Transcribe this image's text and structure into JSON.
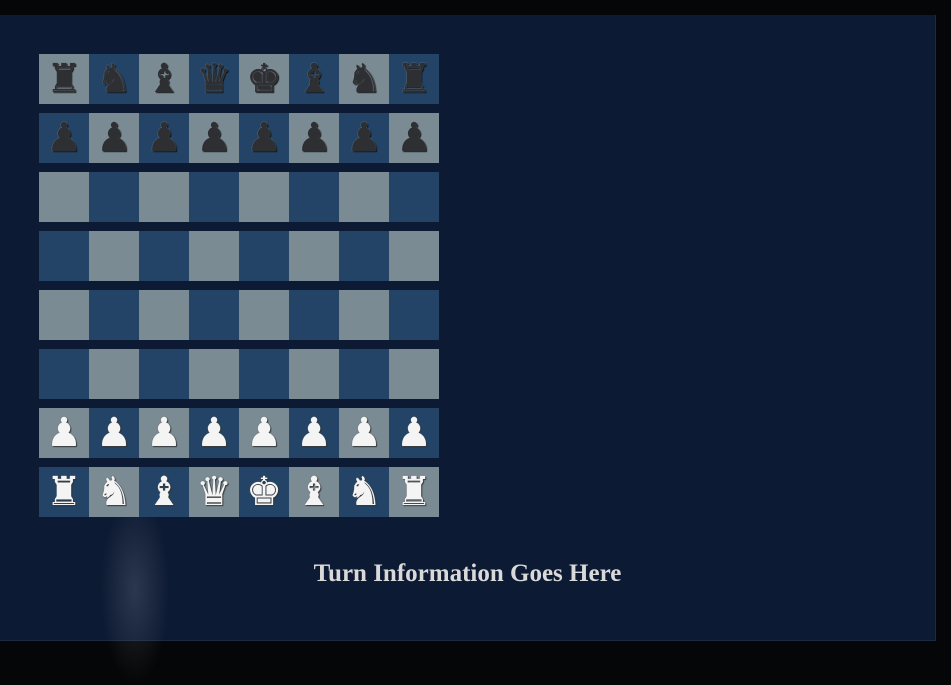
{
  "theme": {
    "panel_bg": "#0d1a33",
    "light_square": "#7a8b93",
    "dark_square": "#234466",
    "turn_text_color": "#d9d9d9"
  },
  "board": {
    "ranks": [
      [
        "black-rook",
        "black-knight",
        "black-bishop",
        "black-queen",
        "black-king",
        "black-bishop",
        "black-knight",
        "black-rook"
      ],
      [
        "black-pawn",
        "black-pawn",
        "black-pawn",
        "black-pawn",
        "black-pawn",
        "black-pawn",
        "black-pawn",
        "black-pawn"
      ],
      [
        "",
        "",
        "",
        "",
        "",
        "",
        "",
        ""
      ],
      [
        "",
        "",
        "",
        "",
        "",
        "",
        "",
        ""
      ],
      [
        "",
        "",
        "",
        "",
        "",
        "",
        "",
        ""
      ],
      [
        "",
        "",
        "",
        "",
        "",
        "",
        "",
        ""
      ],
      [
        "white-pawn",
        "white-pawn",
        "white-pawn",
        "white-pawn",
        "white-pawn",
        "white-pawn",
        "white-pawn",
        "white-pawn"
      ],
      [
        "white-rook",
        "white-knight",
        "white-bishop",
        "white-queen",
        "white-king",
        "white-bishop",
        "white-knight",
        "white-rook"
      ]
    ],
    "glyphs": {
      "king": "♚",
      "queen": "♛",
      "rook": "♜",
      "bishop": "♝",
      "knight": "♞",
      "pawn": "♟"
    }
  },
  "turn_info": "Turn Information Goes Here"
}
